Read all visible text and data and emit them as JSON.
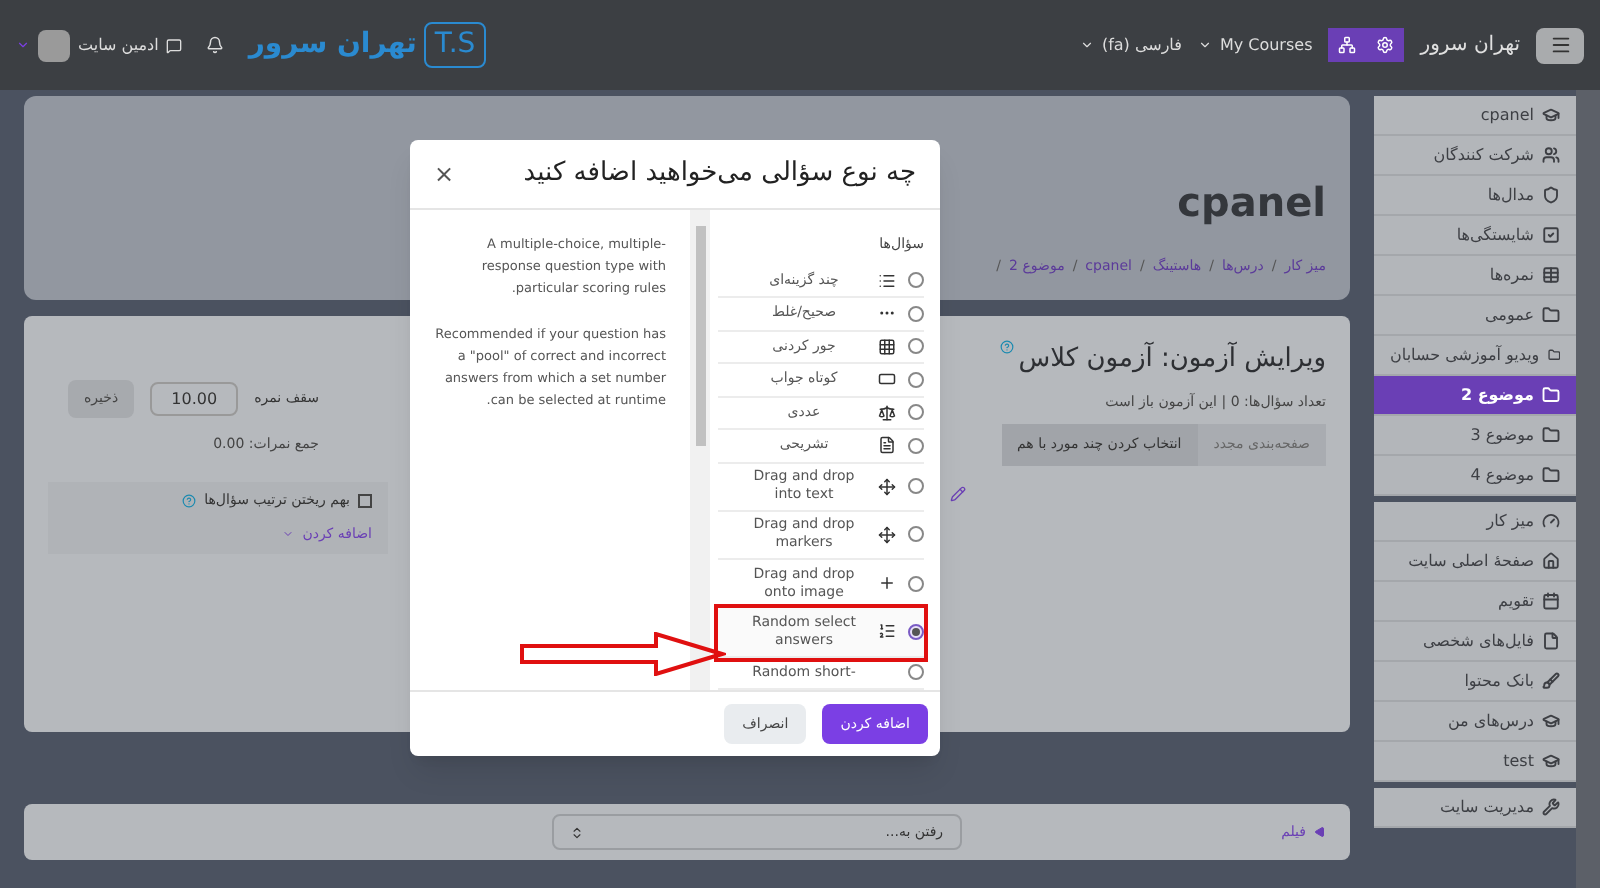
{
  "navbar": {
    "brand": "تهران سرور",
    "logo": {
      "mark": "T.S",
      "text": "تهران سرور"
    },
    "my_courses": "My Courses",
    "language": "فارسی (fa)",
    "user": "ادمین سایت"
  },
  "sidebar": {
    "groups": [
      [
        {
          "label": "cpanel",
          "selected": false
        },
        {
          "label": "شرکت کنندگان",
          "selected": false
        },
        {
          "label": "مدال‌ها",
          "selected": false
        },
        {
          "label": "شایستگی‌ها",
          "selected": false
        },
        {
          "label": "نمره‌ها",
          "selected": false
        },
        {
          "label": "عمومی",
          "selected": false
        },
        {
          "label": "ویدیو آموزشی حسابان",
          "selected": false
        },
        {
          "label": "موضوع 2",
          "selected": true
        },
        {
          "label": "موضوع 3",
          "selected": false
        },
        {
          "label": "موضوع 4",
          "selected": false
        }
      ],
      [
        {
          "label": "میز کار",
          "selected": false
        },
        {
          "label": "صفحهٔ اصلی سایت",
          "selected": false
        },
        {
          "label": "تقویم",
          "selected": false
        },
        {
          "label": "فایل‌های شخصی",
          "selected": false
        },
        {
          "label": "بانک محتوا",
          "selected": false
        },
        {
          "label": "درس‌های من",
          "selected": false
        },
        {
          "label": "test",
          "selected": false
        }
      ],
      [
        {
          "label": "مدیریت سایت",
          "selected": false
        }
      ]
    ]
  },
  "header": {
    "title": "cpanel",
    "breadcrumb": [
      "میز کار",
      "درس‌ها",
      "هاستینگ",
      "cpanel",
      "موضوع 2"
    ],
    "separator": "/"
  },
  "quiz": {
    "title": "ویرایش آزمون: آزمون کلاس",
    "info": "تعداد سؤال‌ها: 0 | این آزمون باز است",
    "buttons": [
      "صفحه‌بندی مجدد",
      "انتخاب کردن چند مورد با هم"
    ],
    "max_grade_label": "سقف نمره",
    "max_grade": "10.00",
    "save": "ذخیره",
    "total": "جمع نمرات: 0.00",
    "shuffle": {
      "label": "بهم ریختن ترتیب سؤال‌ها",
      "checked": false
    },
    "add": "اضافه کردن"
  },
  "footer": {
    "link": "فیلم",
    "jump": "رفتن به..."
  },
  "modal": {
    "title": "چه نوع سؤالی می‌خواهید اضافه کنید",
    "close": "×",
    "section": "سؤال‌ها",
    "options": [
      {
        "label": "چند گزینه‌ای",
        "selected": false
      },
      {
        "label": "صحیح/غلط",
        "selected": false
      },
      {
        "label": "جور کردنی",
        "selected": false
      },
      {
        "label": "کوتاه جواب",
        "selected": false
      },
      {
        "label": "عددی",
        "selected": false
      },
      {
        "label": "تشریحی",
        "selected": false
      },
      {
        "label": "Drag and drop into text",
        "selected": false
      },
      {
        "label": "Drag and drop markers",
        "selected": false
      },
      {
        "label": "Drag and drop onto image",
        "selected": false
      },
      {
        "label": "Random select answers",
        "selected": true
      },
      {
        "label": "Random short-",
        "selected": false
      }
    ],
    "description": [
      "A multiple-choice, multiple-response question type with particular scoring rules.",
      "Recommended if your question has a \"pool\" of correct and incorrect answers from which a set number can be selected at runtime."
    ],
    "buttons": {
      "add": "اضافه کردن",
      "cancel": "انصراف"
    }
  }
}
